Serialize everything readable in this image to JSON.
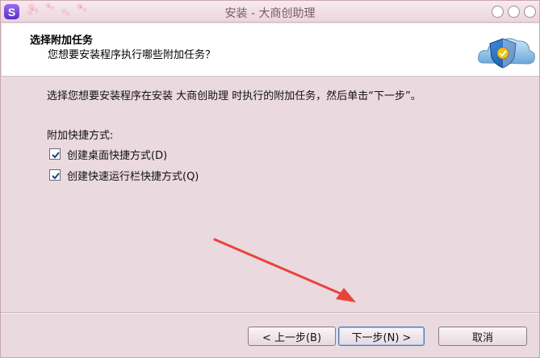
{
  "window": {
    "title": "安装 - 大商创助理",
    "app_icon_letter": "S"
  },
  "header": {
    "title": "选择附加任务",
    "subtitle": "您想要安装程序执行哪些附加任务？"
  },
  "main": {
    "intro": "选择您想要安装程序在安装 大商创助理 时执行的附加任务，然后单击“下一步”。",
    "group_label": "附加快捷方式:",
    "checkboxes": [
      {
        "label": "创建桌面快捷方式(D)",
        "checked": true
      },
      {
        "label": "创建快速运行栏快捷方式(Q)",
        "checked": true
      }
    ]
  },
  "buttons": {
    "back": "< 上一步(B)",
    "next": "下一步(N) >",
    "cancel": "取消"
  },
  "colors": {
    "accent": "#3a7cc7",
    "annotation_arrow": "#e8433b",
    "window_bg": "#ead9de"
  }
}
